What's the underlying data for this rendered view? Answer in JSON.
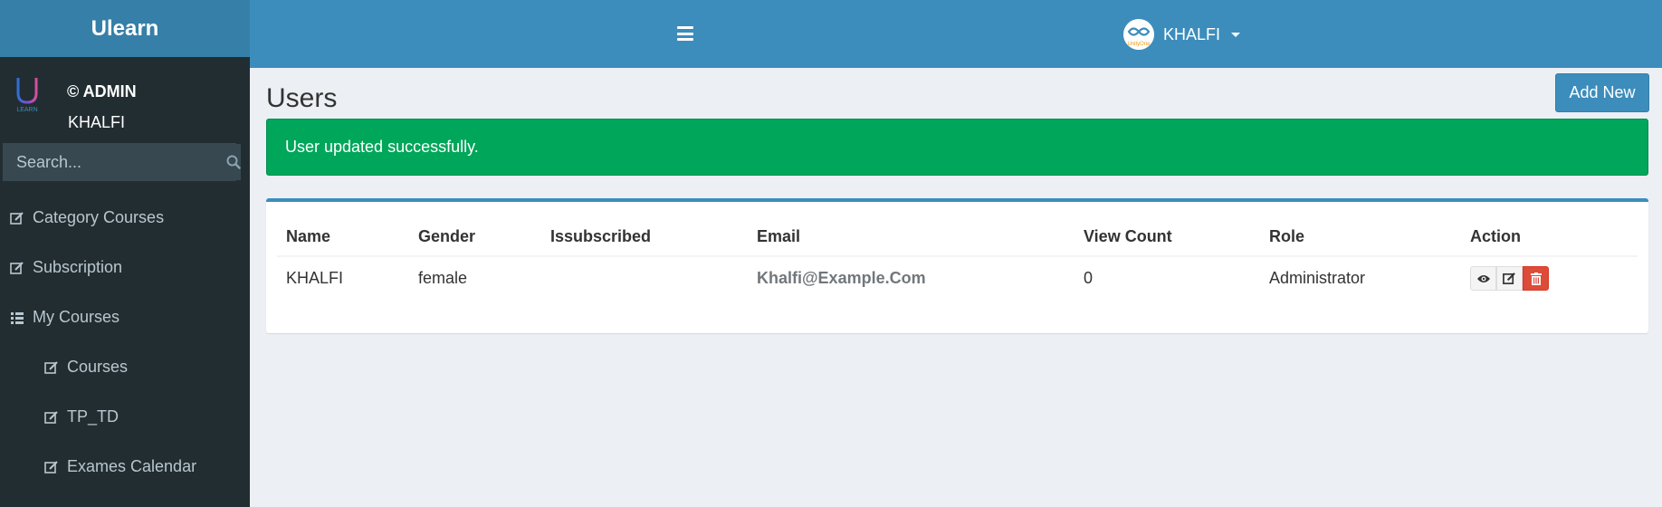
{
  "sidebar": {
    "brand": "Ulearn",
    "logo_text": "LEARN",
    "user_role": "© ADMIN",
    "user_name": "KHALFI",
    "search_placeholder": "Search...",
    "items": [
      {
        "label": "Category Courses",
        "icon": "edit-icon"
      },
      {
        "label": "Subscription",
        "icon": "edit-icon"
      },
      {
        "label": "My Courses",
        "icon": "list-icon"
      },
      {
        "label": "Courses",
        "icon": "edit-icon"
      },
      {
        "label": "TP_TD",
        "icon": "edit-icon"
      },
      {
        "label": "Exames Calendar",
        "icon": "edit-icon"
      }
    ]
  },
  "header": {
    "menu_icon": "hamburger-icon",
    "user_name": "KHALFI",
    "avatar_text": "UnityOne"
  },
  "main": {
    "title": "Users",
    "add_new_label": "Add New",
    "alert_message": "User updated successfully.",
    "table": {
      "columns": [
        "Name",
        "Gender",
        "Issubscribed",
        "Email",
        "View Count",
        "Role",
        "Action"
      ],
      "rows": [
        {
          "name": "KHALFI",
          "gender": "female",
          "issubscribed": "",
          "email": "Khalfi@Example.Com",
          "view_count": "0",
          "role": "Administrator"
        }
      ]
    },
    "action_icons": [
      "eye-icon",
      "edit-icon",
      "trash-icon"
    ]
  },
  "colors": {
    "header": "#3c8dbc",
    "brand": "#367fa9",
    "sidebar": "#222d32",
    "success": "#00a65a",
    "danger": "#dd4b39",
    "background": "#ecf0f5"
  }
}
